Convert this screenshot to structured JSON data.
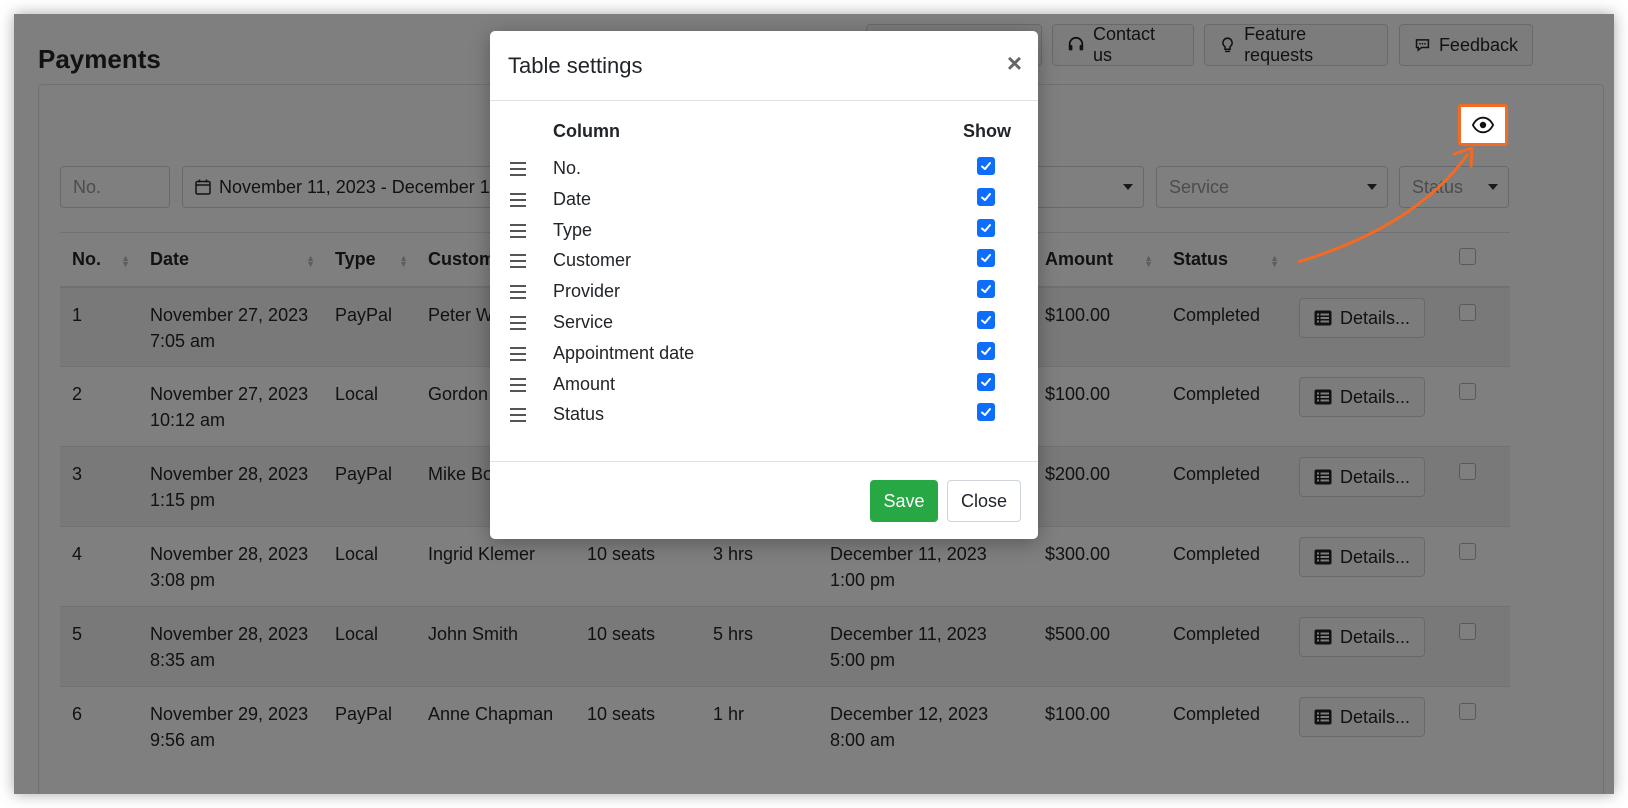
{
  "page": {
    "title": "Payments",
    "header_buttons": [
      {
        "label": "",
        "icon": "blank-button"
      },
      {
        "label": "Contact us",
        "icon": "headset-icon"
      },
      {
        "label": "Feature requests",
        "icon": "lightbulb-icon"
      },
      {
        "label": "Feedback",
        "icon": "chat-icon"
      }
    ]
  },
  "filters": {
    "number_placeholder": "No.",
    "date_range": "November 11, 2023 - December 11, 2023",
    "service_placeholder": "Service",
    "status_placeholder": "Status"
  },
  "table": {
    "headers": [
      "No.",
      "Date",
      "Type",
      "Customer",
      "",
      "",
      "",
      "Amount",
      "Status"
    ],
    "details_label": "Details...",
    "rows": [
      {
        "no": "1",
        "date": "November 27, 2023 7:05 am",
        "type": "PayPal",
        "customer": "Peter Williams",
        "seats": "",
        "duration": "",
        "appointment": "",
        "amount": "$100.00",
        "status": "Completed"
      },
      {
        "no": "2",
        "date": "November 27, 2023 10:12 am",
        "type": "Local",
        "customer": "Gordon",
        "seats": "",
        "duration": "",
        "appointment": "",
        "amount": "$100.00",
        "status": "Completed"
      },
      {
        "no": "3",
        "date": "November 28, 2023 1:15 pm",
        "type": "PayPal",
        "customer": "Mike Boddington",
        "seats": "",
        "duration": "",
        "appointment": "",
        "amount": "$200.00",
        "status": "Completed"
      },
      {
        "no": "4",
        "date": "November 28, 2023 3:08 pm",
        "type": "Local",
        "customer": "Ingrid Klemer",
        "seats": "10 seats",
        "duration": "3 hrs",
        "appointment": "December 11, 2023 1:00 pm",
        "amount": "$300.00",
        "status": "Completed"
      },
      {
        "no": "5",
        "date": "November 28, 2023 8:35 am",
        "type": "Local",
        "customer": "John Smith",
        "seats": "10 seats",
        "duration": "5 hrs",
        "appointment": "December 11, 2023 5:00 pm",
        "amount": "$500.00",
        "status": "Completed"
      },
      {
        "no": "6",
        "date": "November 29, 2023 9:56 am",
        "type": "PayPal",
        "customer": "Anne Chapman",
        "seats": "10 seats",
        "duration": "1 hr",
        "appointment": "December 12, 2023 8:00 am",
        "amount": "$100.00",
        "status": "Completed"
      }
    ]
  },
  "modal": {
    "title": "Table settings",
    "close_symbol": "×",
    "column_header": "Column",
    "show_header": "Show",
    "columns": [
      {
        "label": "No.",
        "checked": true
      },
      {
        "label": "Date",
        "checked": true
      },
      {
        "label": "Type",
        "checked": true
      },
      {
        "label": "Customer",
        "checked": true
      },
      {
        "label": "Provider",
        "checked": true
      },
      {
        "label": "Service",
        "checked": true
      },
      {
        "label": "Appointment date",
        "checked": true
      },
      {
        "label": "Amount",
        "checked": true
      },
      {
        "label": "Status",
        "checked": true
      }
    ],
    "save_label": "Save",
    "close_label": "Close"
  },
  "colors": {
    "accent_orange": "#f26a24",
    "checkbox_blue": "#0d6efd",
    "save_green": "#28a745"
  }
}
